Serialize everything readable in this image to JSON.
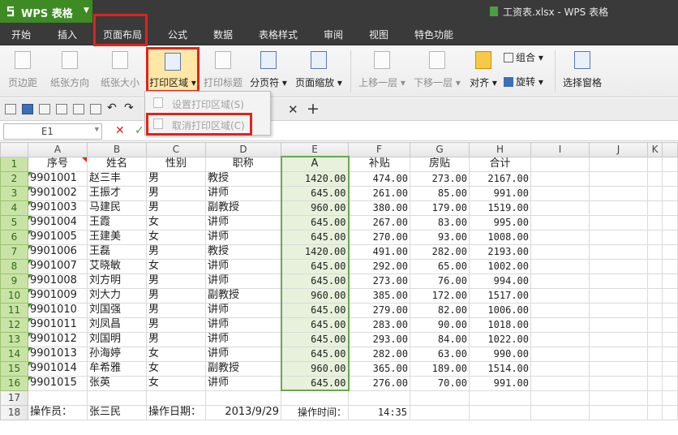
{
  "app": {
    "name": "WPS 表格",
    "doc_title": "工资表.xlsx - WPS 表格"
  },
  "menu": {
    "tabs": [
      "开始",
      "插入",
      "页面布局",
      "公式",
      "数据",
      "表格样式",
      "审阅",
      "视图",
      "特色功能"
    ],
    "active": "页面布局"
  },
  "ribbon": {
    "margins": "页边距",
    "orientation": "纸张方向",
    "size": "纸张大小",
    "print_area": "打印区域",
    "print_titles": "打印标题",
    "page_break": "分页符",
    "page_zoom": "页面缩放",
    "bring_forward": "上移一层",
    "send_backward": "下移一层",
    "align": "对齐",
    "group": "组合",
    "rotate": "旋转",
    "selection_pane": "选择窗格"
  },
  "dropdown": {
    "set_area": "设置打印区域(S)",
    "cancel_area": "取消打印区域(C)"
  },
  "formula_bar": {
    "name_box": "E1"
  },
  "sheet": {
    "col_letters": [
      "A",
      "B",
      "C",
      "D",
      "E",
      "F",
      "G",
      "H",
      "I",
      "J",
      "K"
    ],
    "header_row": [
      "序号",
      "姓名",
      "性别",
      "职称",
      "A",
      "补贴",
      "房贴",
      "合计"
    ],
    "rows": [
      [
        "9901001",
        "赵三丰",
        "男",
        "教授",
        "1420.00",
        "474.00",
        "273.00",
        "2167.00"
      ],
      [
        "9901002",
        "王振才",
        "男",
        "讲师",
        "645.00",
        "261.00",
        "85.00",
        "991.00"
      ],
      [
        "9901003",
        "马建民",
        "男",
        "副教授",
        "960.00",
        "380.00",
        "179.00",
        "1519.00"
      ],
      [
        "9901004",
        "王霞",
        "女",
        "讲师",
        "645.00",
        "267.00",
        "83.00",
        "995.00"
      ],
      [
        "9901005",
        "王建美",
        "女",
        "讲师",
        "645.00",
        "270.00",
        "93.00",
        "1008.00"
      ],
      [
        "9901006",
        "王磊",
        "男",
        "教授",
        "1420.00",
        "491.00",
        "282.00",
        "2193.00"
      ],
      [
        "9901007",
        "艾晓敏",
        "女",
        "讲师",
        "645.00",
        "292.00",
        "65.00",
        "1002.00"
      ],
      [
        "9901008",
        "刘方明",
        "男",
        "讲师",
        "645.00",
        "273.00",
        "76.00",
        "994.00"
      ],
      [
        "9901009",
        "刘大力",
        "男",
        "副教授",
        "960.00",
        "385.00",
        "172.00",
        "1517.00"
      ],
      [
        "9901010",
        "刘国强",
        "男",
        "讲师",
        "645.00",
        "279.00",
        "82.00",
        "1006.00"
      ],
      [
        "9901011",
        "刘凤昌",
        "男",
        "讲师",
        "645.00",
        "283.00",
        "90.00",
        "1018.00"
      ],
      [
        "9901012",
        "刘国明",
        "男",
        "讲师",
        "645.00",
        "293.00",
        "84.00",
        "1022.00"
      ],
      [
        "9901013",
        "孙海婷",
        "女",
        "讲师",
        "645.00",
        "282.00",
        "63.00",
        "990.00"
      ],
      [
        "9901014",
        "牟希雅",
        "女",
        "副教授",
        "960.00",
        "365.00",
        "189.00",
        "1514.00"
      ],
      [
        "9901015",
        "张英",
        "女",
        "讲师",
        "645.00",
        "276.00",
        "70.00",
        "991.00"
      ]
    ],
    "footer": {
      "operator_label": "操作员：",
      "operator": "张三民",
      "date_label": "操作日期：",
      "date": "2013/9/29",
      "time_label": "操作时间：",
      "time": "14:35"
    }
  },
  "colors": {
    "app_green": "#3d8b22",
    "highlight_red": "#e0231c",
    "selection_green": "#c9e3a7"
  }
}
